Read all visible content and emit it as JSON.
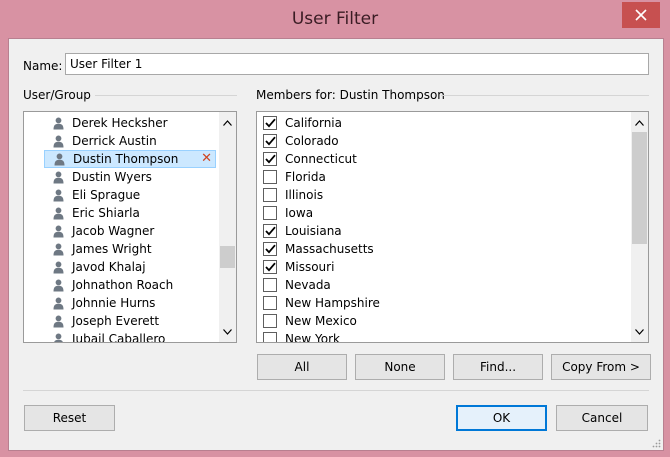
{
  "window": {
    "title": "User Filter",
    "close_icon": "close-icon",
    "accent": "#d892a3",
    "close_bg": "#c75050"
  },
  "name": {
    "label": "Name:",
    "value": "User Filter 1"
  },
  "user_group": {
    "label": "User/Group",
    "users": [
      {
        "name": "Derek Hecksher",
        "selected": false
      },
      {
        "name": "Derrick Austin",
        "selected": false
      },
      {
        "name": "Dustin Thompson",
        "selected": true
      },
      {
        "name": "Dustin Wyers",
        "selected": false
      },
      {
        "name": "Eli Sprague",
        "selected": false
      },
      {
        "name": "Eric Shiarla",
        "selected": false
      },
      {
        "name": "Jacob Wagner",
        "selected": false
      },
      {
        "name": "James Wright",
        "selected": false
      },
      {
        "name": "Javod Khalaj",
        "selected": false
      },
      {
        "name": "Johnathon Roach",
        "selected": false
      },
      {
        "name": "Johnnie Hurns",
        "selected": false
      },
      {
        "name": "Joseph Everett",
        "selected": false
      },
      {
        "name": "Jubail Caballero",
        "selected": false
      }
    ],
    "remove_icon": "remove-x-icon"
  },
  "members": {
    "label": "Members for: Dustin Thompson",
    "items": [
      {
        "name": "California",
        "checked": true
      },
      {
        "name": "Colorado",
        "checked": true
      },
      {
        "name": "Connecticut",
        "checked": true
      },
      {
        "name": "Florida",
        "checked": false
      },
      {
        "name": "Illinois",
        "checked": false
      },
      {
        "name": "Iowa",
        "checked": false
      },
      {
        "name": "Louisiana",
        "checked": true
      },
      {
        "name": "Massachusetts",
        "checked": true
      },
      {
        "name": "Missouri",
        "checked": true
      },
      {
        "name": "Nevada",
        "checked": false
      },
      {
        "name": "New Hampshire",
        "checked": false
      },
      {
        "name": "New Mexico",
        "checked": false
      },
      {
        "name": "New York",
        "checked": false
      }
    ]
  },
  "buttons": {
    "all": "All",
    "none": "None",
    "find": "Find...",
    "copy_from": "Copy From >",
    "reset": "Reset",
    "ok": "OK",
    "cancel": "Cancel"
  }
}
